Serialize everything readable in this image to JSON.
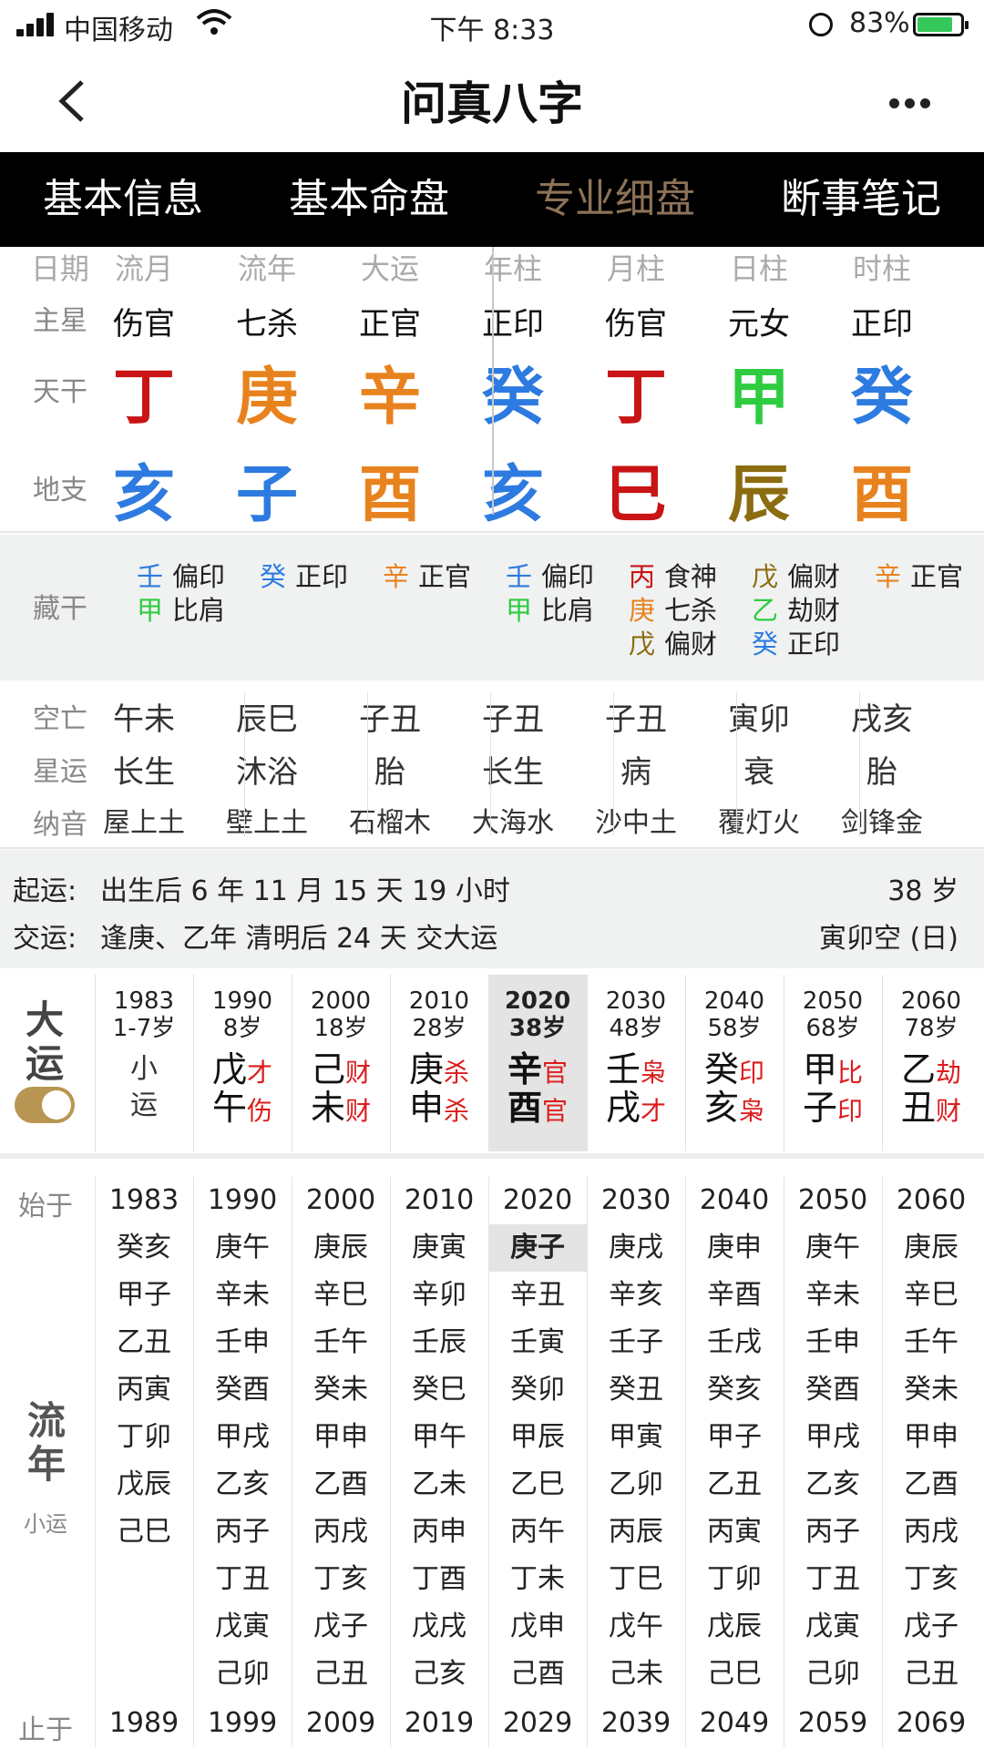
{
  "status": {
    "carrier": "中国移动",
    "time": "下午 8:33",
    "battery": "83%"
  },
  "nav": {
    "title": "问真八字"
  },
  "tabs": [
    {
      "label": "基本信息"
    },
    {
      "label": "基本命盘"
    },
    {
      "label": "专业细盘"
    },
    {
      "label": "断事笔记"
    }
  ],
  "pillars": {
    "header_label": "日期",
    "headers": [
      "流月",
      "流年",
      "大运",
      "年柱",
      "月柱",
      "日柱",
      "时柱"
    ],
    "zhuxing_label": "主星",
    "zhuxing": [
      "伤官",
      "七杀",
      "正官",
      "正印",
      "伤官",
      "元女",
      "正印"
    ],
    "tiangan_label": "天干",
    "tiangan": [
      "丁",
      "庚",
      "辛",
      "癸",
      "丁",
      "甲",
      "癸"
    ],
    "dizhi_label": "地支",
    "dizhi": [
      "亥",
      "子",
      "酉",
      "亥",
      "巳",
      "辰",
      "酉"
    ]
  },
  "colors": {
    "red": "#c81414",
    "orange": "#e8821e",
    "blue": "#2d7be0",
    "green": "#2ecc40",
    "olive": "#8b6c10",
    "tab_active": "#8c7257"
  },
  "canggan": {
    "label": "藏干",
    "cols": [
      [
        {
          "g": "壬",
          "t": "偏印"
        },
        {
          "g": "甲",
          "t": "比肩"
        }
      ],
      [
        {
          "g": "癸",
          "t": "正印"
        }
      ],
      [
        {
          "g": "辛",
          "t": "正官"
        }
      ],
      [
        {
          "g": "壬",
          "t": "偏印"
        },
        {
          "g": "甲",
          "t": "比肩"
        }
      ],
      [
        {
          "g": "丙",
          "t": "食神"
        },
        {
          "g": "庚",
          "t": "七杀"
        },
        {
          "g": "戊",
          "t": "偏财"
        }
      ],
      [
        {
          "g": "戊",
          "t": "偏财"
        },
        {
          "g": "乙",
          "t": "劫财"
        },
        {
          "g": "癸",
          "t": "正印"
        }
      ],
      [
        {
          "g": "辛",
          "t": "正官"
        }
      ]
    ]
  },
  "kongwang": {
    "label": "空亡",
    "values": [
      "午未",
      "辰巳",
      "子丑",
      "子丑",
      "子丑",
      "寅卯",
      "戌亥"
    ]
  },
  "xingyun": {
    "label": "星运",
    "values": [
      "长生",
      "沐浴",
      "胎",
      "长生",
      "病",
      "衰",
      "胎"
    ]
  },
  "nayin": {
    "label": "纳音",
    "values": [
      "屋上土",
      "壁上土",
      "石榴木",
      "大海水",
      "沙中土",
      "覆灯火",
      "剑锋金"
    ]
  },
  "qiyun": {
    "label": "起运:",
    "text": "出生后 6 年 11 月 15 天 19 小时",
    "age": "38 岁"
  },
  "jiaoyun": {
    "label": "交运:",
    "text": "逢庚、乙年 清明后 24 天 交大运",
    "kong": "寅卯空 (日)"
  },
  "dayun": {
    "label_1": "大",
    "label_2": "运",
    "cols": [
      {
        "year": "1983",
        "age": "1-7岁",
        "g": "小",
        "z": "运",
        "gt": "",
        "zt": ""
      },
      {
        "year": "1990",
        "age": "8岁",
        "g": "戊",
        "z": "午",
        "gt": "才",
        "zt": "伤"
      },
      {
        "year": "2000",
        "age": "18岁",
        "g": "己",
        "z": "未",
        "gt": "财",
        "zt": "财"
      },
      {
        "year": "2010",
        "age": "28岁",
        "g": "庚",
        "z": "申",
        "gt": "杀",
        "zt": "杀"
      },
      {
        "year": "2020",
        "age": "38岁",
        "g": "辛",
        "z": "酉",
        "gt": "官",
        "zt": "官"
      },
      {
        "year": "2030",
        "age": "48岁",
        "g": "壬",
        "z": "戌",
        "gt": "枭",
        "zt": "才"
      },
      {
        "year": "2040",
        "age": "58岁",
        "g": "癸",
        "z": "亥",
        "gt": "印",
        "zt": "枭"
      },
      {
        "year": "2050",
        "age": "68岁",
        "g": "甲",
        "z": "子",
        "gt": "比",
        "zt": "印"
      },
      {
        "year": "2060",
        "age": "78岁",
        "g": "乙",
        "z": "丑",
        "gt": "劫",
        "zt": "财"
      }
    ]
  },
  "liunian": {
    "start_label": "始于",
    "end_label": "止于",
    "label_1": "流",
    "label_2": "年",
    "small_label": "小运",
    "cols": [
      {
        "start": "1983",
        "end": "1989",
        "years": [
          "癸亥",
          "甲子",
          "乙丑",
          "丙寅",
          "丁卯",
          "戊辰",
          "己巳"
        ]
      },
      {
        "start": "1990",
        "end": "1999",
        "years": [
          "庚午",
          "辛未",
          "壬申",
          "癸酉",
          "甲戌",
          "乙亥",
          "丙子",
          "丁丑",
          "戊寅",
          "己卯"
        ]
      },
      {
        "start": "2000",
        "end": "2009",
        "years": [
          "庚辰",
          "辛巳",
          "壬午",
          "癸未",
          "甲申",
          "乙酉",
          "丙戌",
          "丁亥",
          "戊子",
          "己丑"
        ]
      },
      {
        "start": "2010",
        "end": "2019",
        "years": [
          "庚寅",
          "辛卯",
          "壬辰",
          "癸巳",
          "甲午",
          "乙未",
          "丙申",
          "丁酉",
          "戊戌",
          "己亥"
        ]
      },
      {
        "start": "2020",
        "end": "2029",
        "years": [
          "庚子",
          "辛丑",
          "壬寅",
          "癸卯",
          "甲辰",
          "乙巳",
          "丙午",
          "丁未",
          "戊申",
          "己酉"
        ]
      },
      {
        "start": "2030",
        "end": "2039",
        "years": [
          "庚戌",
          "辛亥",
          "壬子",
          "癸丑",
          "甲寅",
          "乙卯",
          "丙辰",
          "丁巳",
          "戊午",
          "己未"
        ]
      },
      {
        "start": "2040",
        "end": "2049",
        "years": [
          "庚申",
          "辛酉",
          "壬戌",
          "癸亥",
          "甲子",
          "乙丑",
          "丙寅",
          "丁卯",
          "戊辰",
          "己巳"
        ]
      },
      {
        "start": "2050",
        "end": "2059",
        "years": [
          "庚午",
          "辛未",
          "壬申",
          "癸酉",
          "甲戌",
          "乙亥",
          "丙子",
          "丁丑",
          "戊寅",
          "己卯"
        ]
      },
      {
        "start": "2060",
        "end": "2069",
        "years": [
          "庚辰",
          "辛巳",
          "壬午",
          "癸未",
          "甲申",
          "乙酉",
          "丙戌",
          "丁亥",
          "戊子",
          "己丑"
        ]
      }
    ]
  }
}
